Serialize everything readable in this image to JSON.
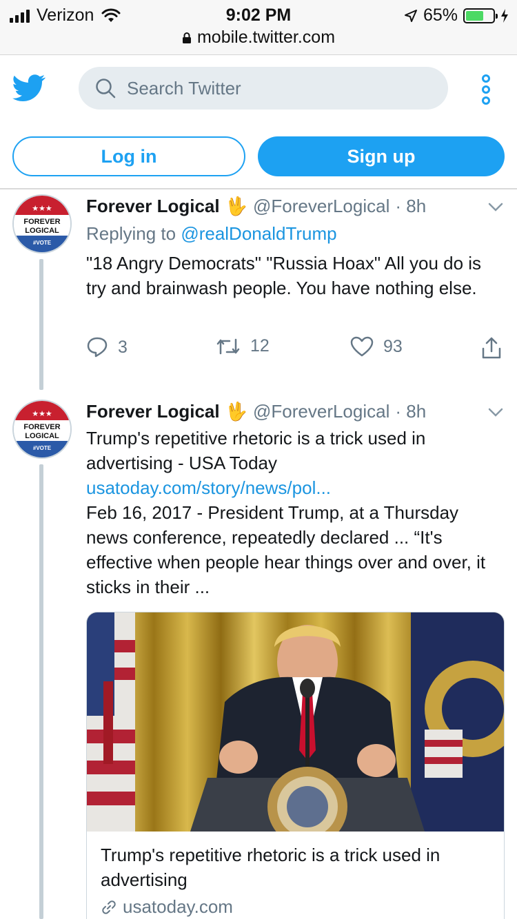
{
  "status_bar": {
    "carrier": "Verizon",
    "time": "9:02 PM",
    "battery": "65%",
    "battery_level": 0.65,
    "url": "mobile.twitter.com"
  },
  "header": {
    "search_placeholder": "Search Twitter",
    "login_label": "Log in",
    "signup_label": "Sign up"
  },
  "tweets": [
    {
      "name": "Forever Logical",
      "emoji": "🖖",
      "handle": "@ForeverLogical",
      "time": "· 8h",
      "reply_prefix": "Replying to",
      "reply_to": "@realDonaldTrump",
      "text": "\"18 Angry Democrats\" \"Russia Hoax\" All you do is try and brainwash people. You have nothing else.",
      "replies": "3",
      "retweets": "12",
      "likes": "93"
    },
    {
      "name": "Forever Logical",
      "emoji": "🖖",
      "handle": "@ForeverLogical",
      "time": "· 8h",
      "text_title": "Trump's repetitive rhetoric is a trick used in advertising - USA Today",
      "link": "usatoday.com/story/news/pol...",
      "text_body": "Feb 16, 2017 - President Trump, at a Thursday news conference, repeatedly declared ... “It's effective when people hear things over and over, it sticks in their ...",
      "card": {
        "title": "Trump's repetitive rhetoric is a trick used in advertising",
        "domain": "usatoday.com"
      }
    }
  ],
  "avatar_badge": {
    "stars": "★★★",
    "line1": "FOREVER",
    "line2": "LOGICAL",
    "line3": "#VOTE"
  },
  "colors": {
    "twitter_blue": "#1da1f2",
    "link_blue": "#1b95e0",
    "gray_text": "#657786",
    "battery_green": "#4cd964"
  }
}
